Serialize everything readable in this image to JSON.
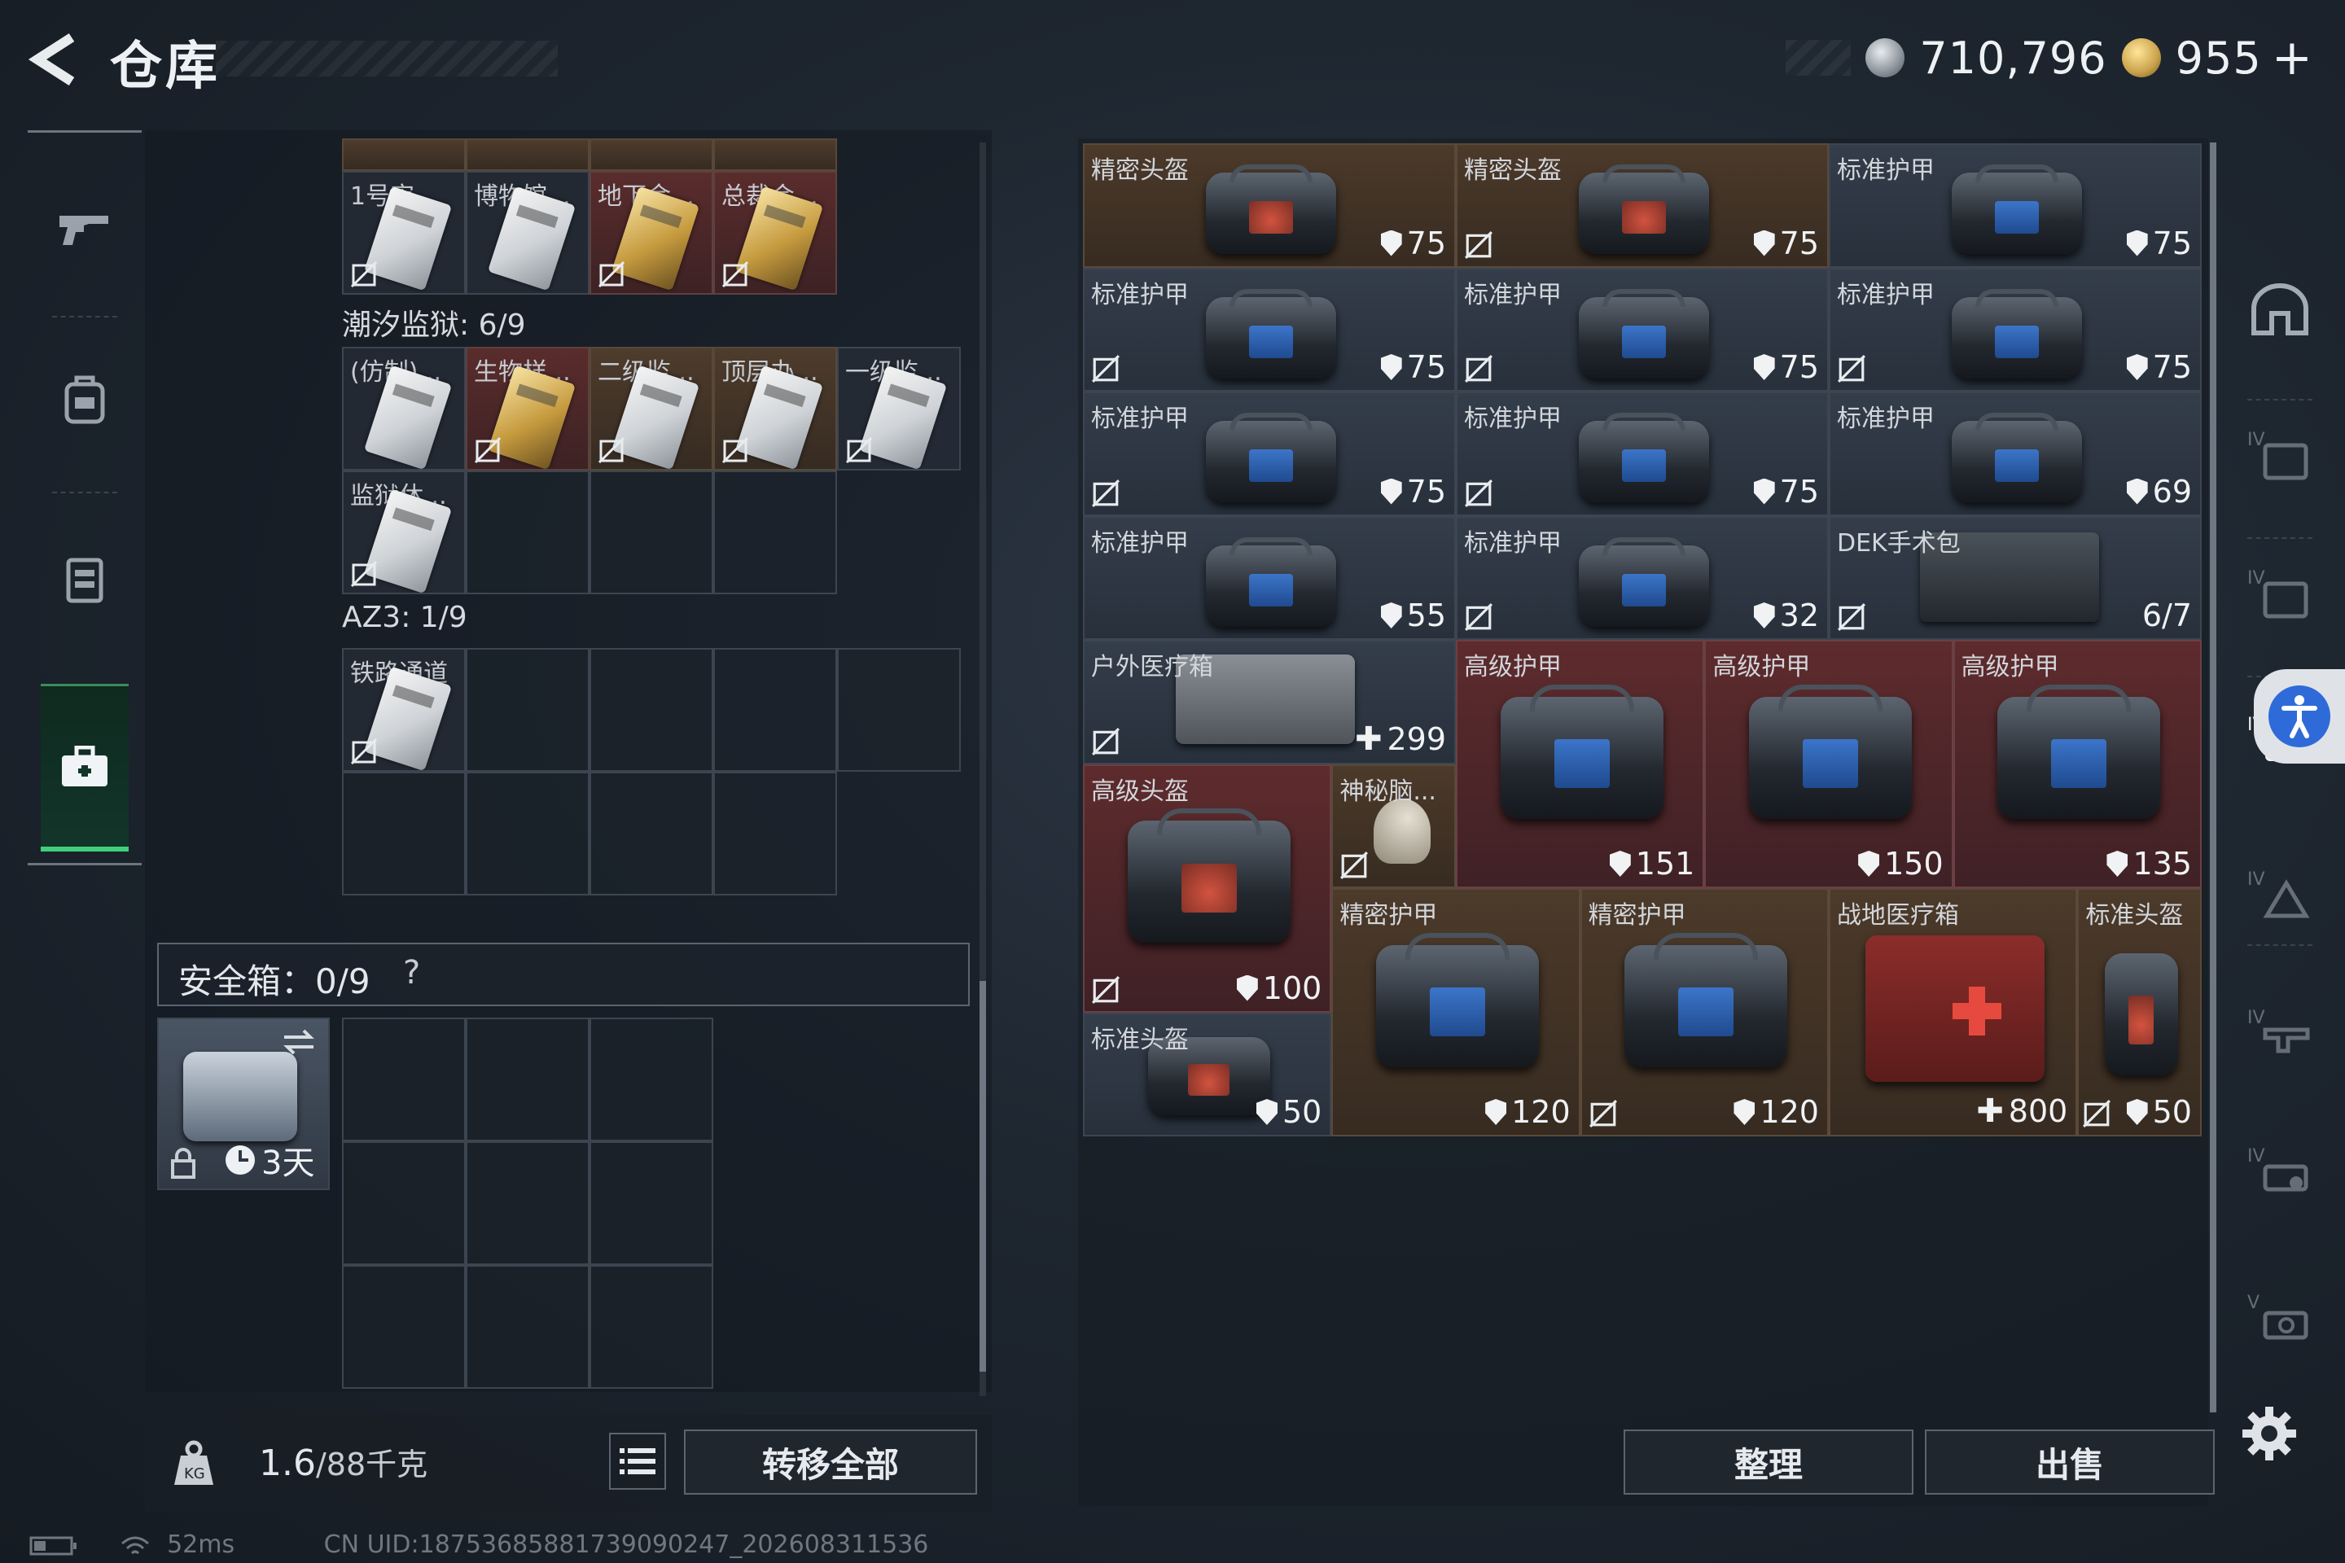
{
  "header": {
    "title": "仓库",
    "silver_value": "710,796",
    "gold_value": "955",
    "gold_plus": "+"
  },
  "left_panel": {
    "row0_labels": [
      "1号审...",
      "博物馆...",
      "地下金...",
      "总裁会..."
    ],
    "prison_group": {
      "title": "潮汐监狱: 6/9",
      "items": [
        "(仿制)...",
        "生物样...",
        "二级监...",
        "顶层办...",
        "一级监...",
        "监狱休..."
      ]
    },
    "az3_group": {
      "title": "AZ3: 1/9",
      "items": [
        "铁路通道"
      ]
    },
    "safe_box": {
      "label": "安全箱：0/9",
      "help": "?",
      "timer": "3天"
    },
    "weight": {
      "current": "1.6",
      "capacity": "/88千克"
    },
    "transfer_all": "转移全部"
  },
  "right_panel": {
    "items": [
      {
        "label": "精密头盔",
        "value": "75",
        "kind": "shield"
      },
      {
        "label": "精密头盔",
        "value": "75",
        "kind": "shield"
      },
      {
        "label": "标准护甲",
        "value": "75",
        "kind": "shield"
      },
      {
        "label": "标准护甲",
        "value": "75",
        "kind": "shield"
      },
      {
        "label": "标准护甲",
        "value": "75",
        "kind": "shield"
      },
      {
        "label": "标准护甲",
        "value": "75",
        "kind": "shield"
      },
      {
        "label": "标准护甲",
        "value": "75",
        "kind": "shield"
      },
      {
        "label": "标准护甲",
        "value": "75",
        "kind": "shield"
      },
      {
        "label": "标准护甲",
        "value": "69",
        "kind": "shield"
      },
      {
        "label": "标准护甲",
        "value": "55",
        "kind": "shield"
      },
      {
        "label": "标准护甲",
        "value": "32",
        "kind": "shield"
      },
      {
        "label": "DEK手术包",
        "value": "6/7",
        "kind": "count"
      },
      {
        "label": "户外医疗箱",
        "value": "299",
        "kind": "heal"
      },
      {
        "label": "高级护甲",
        "value": "151",
        "kind": "shield"
      },
      {
        "label": "高级护甲",
        "value": "150",
        "kind": "shield"
      },
      {
        "label": "高级护甲",
        "value": "135",
        "kind": "shield"
      },
      {
        "label": "高级头盔",
        "value": "100",
        "kind": "shield"
      },
      {
        "label": "神秘脑...",
        "value": "",
        "kind": "none"
      },
      {
        "label": "精密护甲",
        "value": "120",
        "kind": "shield"
      },
      {
        "label": "精密护甲",
        "value": "120",
        "kind": "shield"
      },
      {
        "label": "战地医疗箱",
        "value": "800",
        "kind": "heal"
      },
      {
        "label": "标准头盔",
        "value": "50",
        "kind": "shield"
      },
      {
        "label": "标准头盔",
        "value": "50",
        "kind": "shield"
      }
    ],
    "sort_label": "整理",
    "sell_label": "出售"
  },
  "status_bar": {
    "ping": "52ms",
    "uid": "CN UID:18753685881739090247_202608311536"
  },
  "colors": {
    "accent_green": "#3fd07a",
    "rare_red": "#5e2b2d",
    "rare_brown": "#4c3a2a",
    "access_blue": "#2f6bd8"
  }
}
